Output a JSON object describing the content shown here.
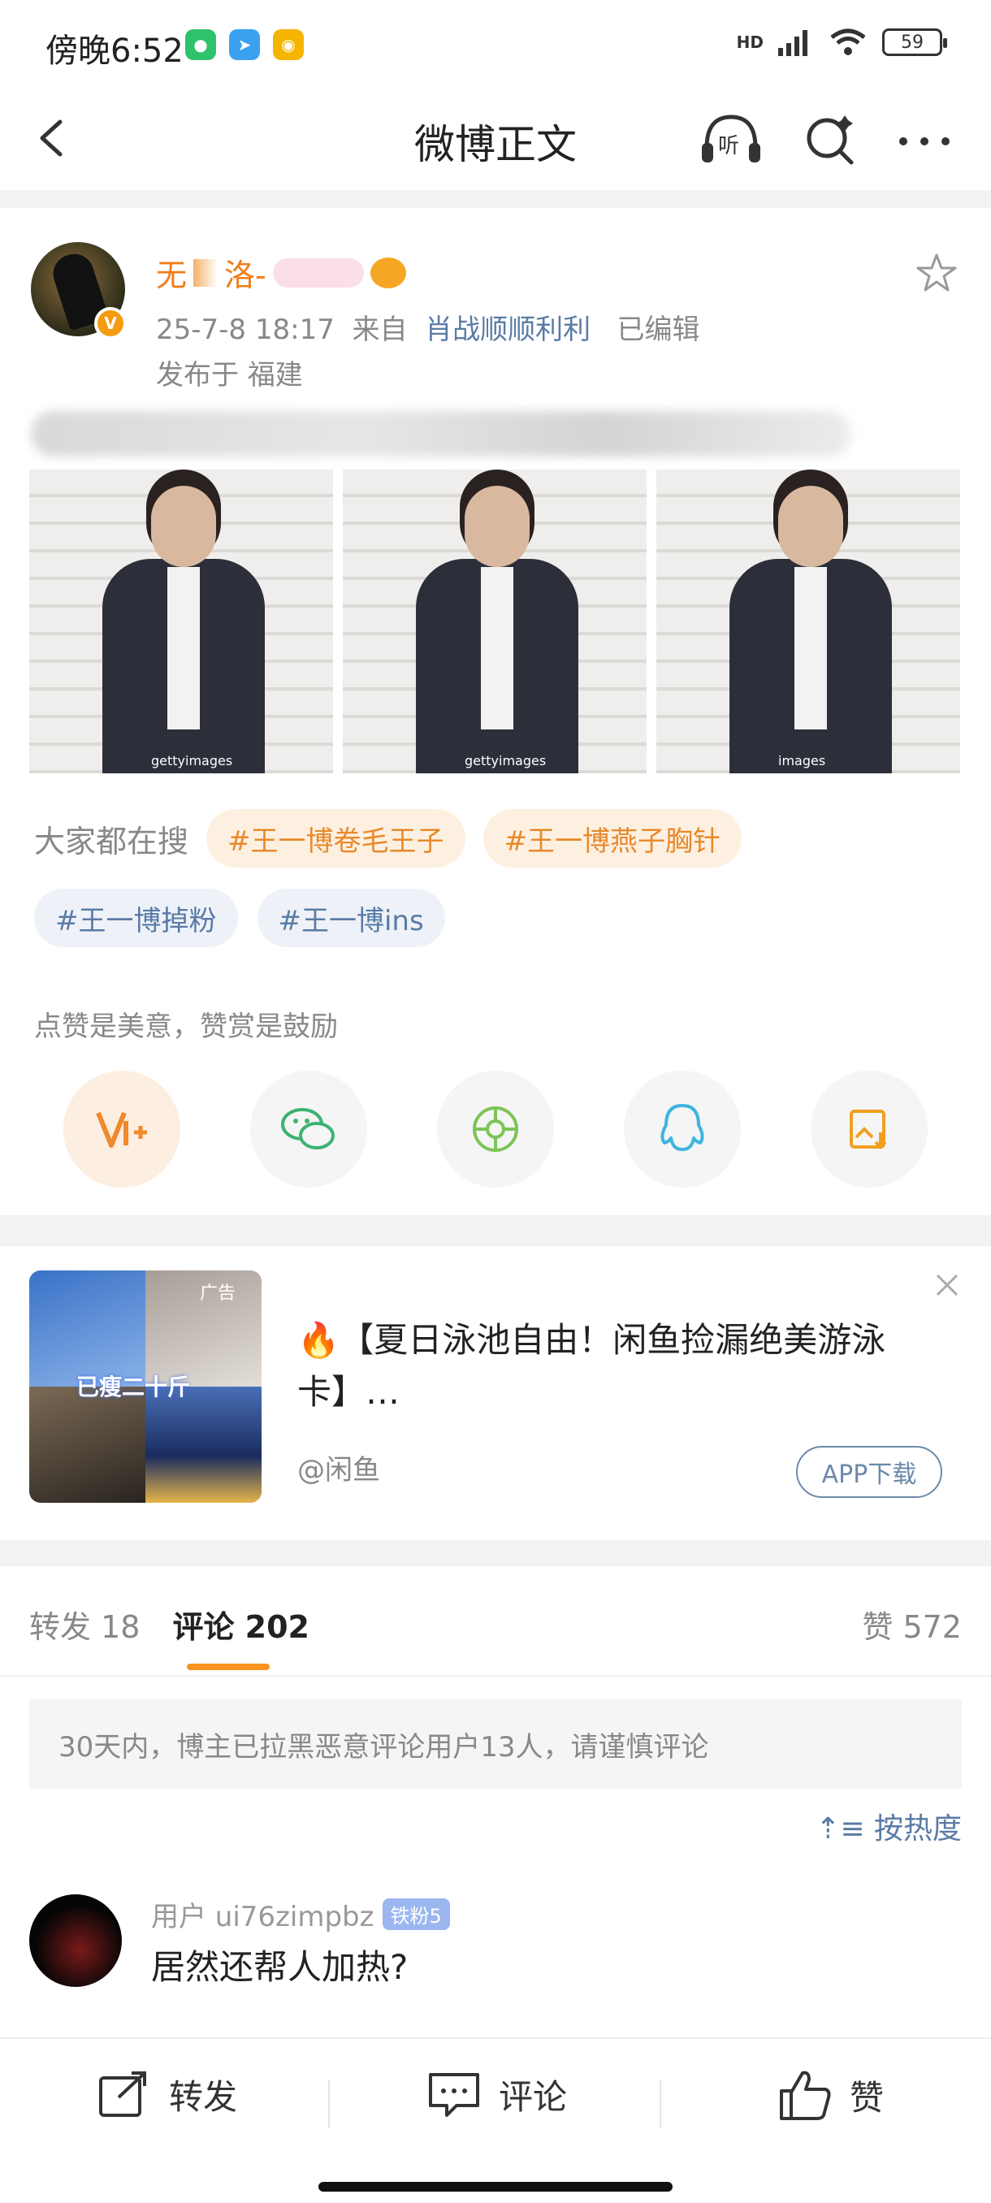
{
  "status_bar": {
    "time": "傍晚6:52",
    "network": "HD",
    "battery": "59"
  },
  "nav": {
    "title": "微博正文"
  },
  "post": {
    "author": {
      "name": "无",
      "name_part2": "洛-"
    },
    "date": "25-7-8 18:17",
    "from_label": "来自",
    "source": "肖战顺顺利利",
    "edited": "已编辑",
    "location": "发布于 福建",
    "photos": [
      {
        "watermark": "gettyimages"
      },
      {
        "watermark": "gettyimages"
      },
      {
        "watermark": "images"
      }
    ]
  },
  "hot_search": {
    "label": "大家都在搜",
    "tags": [
      "#王一博卷毛王子",
      "#王一博燕子胸针",
      "#王一博掉粉",
      "#王一博ins"
    ]
  },
  "reward": {
    "text": "点赞是美意，赞赏是鼓励"
  },
  "ad": {
    "tag": "广告",
    "sticker_text": "已瘦二十斤",
    "headline": "【夏日泳池自由！闲鱼捡漏绝美游泳卡】…",
    "source": "@闲鱼",
    "download_label": "APP下载"
  },
  "tabs": {
    "repost": "转发 18",
    "comment": "评论 202",
    "likes": "赞 572"
  },
  "comments": {
    "notice": "30天内，博主已拉黑恶意评论用户13人，请谨慎评论",
    "sort_label": "按热度",
    "items": [
      {
        "user": "用户 ui76zimpbz",
        "fan_badge": "铁粉5",
        "text": "居然还帮人加热?"
      }
    ]
  },
  "bottom_bar": {
    "repost": "转发",
    "comment": "评论",
    "like": "赞"
  }
}
